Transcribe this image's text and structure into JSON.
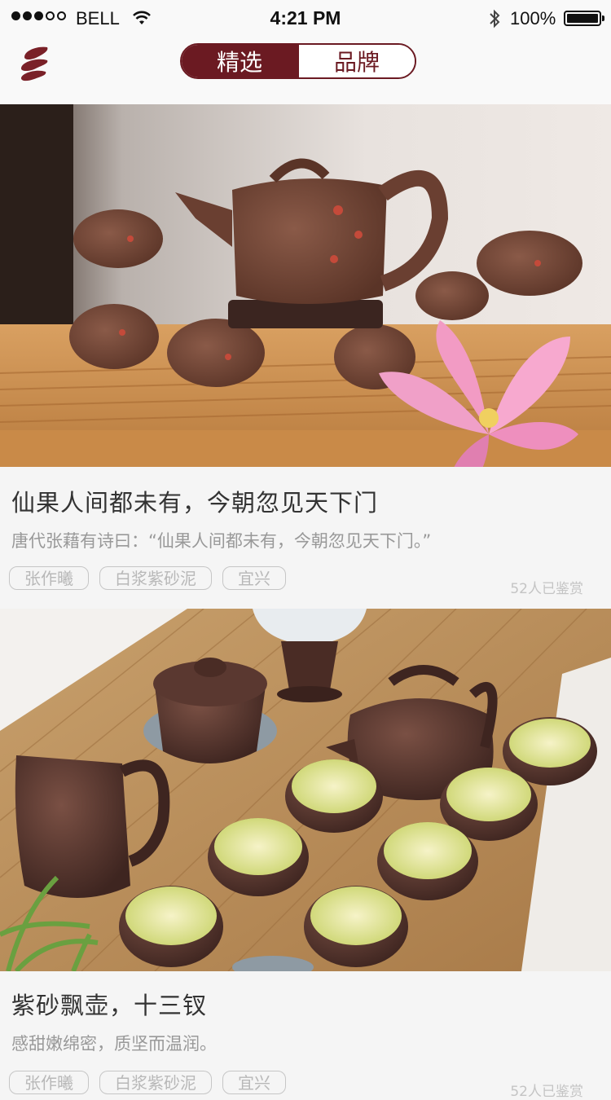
{
  "status_bar": {
    "carrier": "BELL",
    "time": "4:21 PM",
    "battery": "100%"
  },
  "nav": {
    "tabs": [
      {
        "label": "精选",
        "active": true
      },
      {
        "label": "品牌",
        "active": false
      }
    ],
    "accent_color": "#6b1a22"
  },
  "cards": [
    {
      "title": "仙果人间都未有，今朝忽见天下门",
      "description": "唐代张藉有诗曰：“仙果人间都未有，今朝忽见天下门。”",
      "tags": [
        "张作曦",
        "白浆紫砂泥",
        "宜兴"
      ],
      "views": "52人已鉴赏",
      "photo": "teapot-set-with-pink-flower"
    },
    {
      "title": "紫砂飘壶，十三钗",
      "description": "感甜嫩绵密，质坚而温润。",
      "tags": [
        "张作曦",
        "白浆紫砂泥",
        "宜兴"
      ],
      "views": "52人已鉴赏",
      "photo": "tea-set-with-green-tea-cups"
    }
  ]
}
